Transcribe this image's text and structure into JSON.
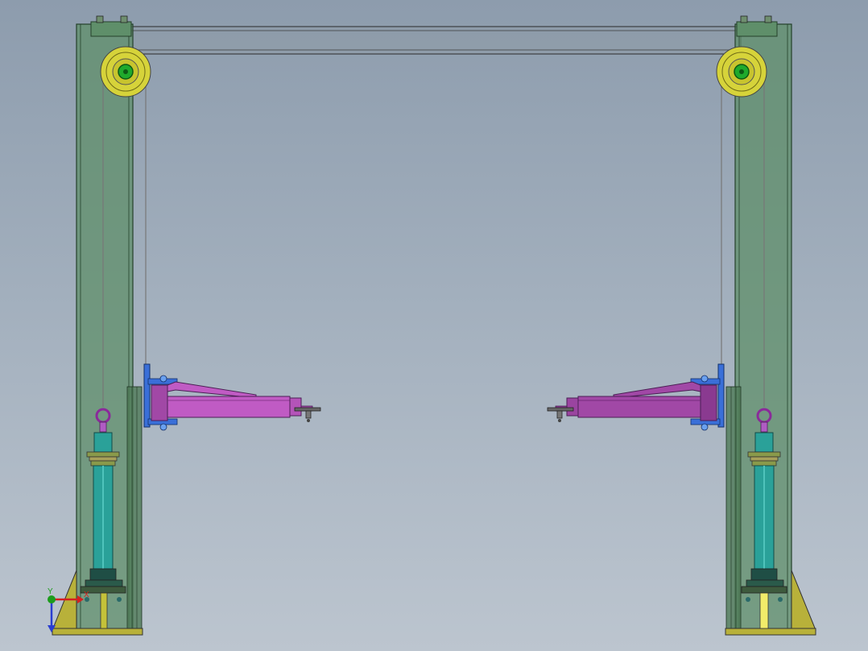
{
  "scene": {
    "title": "",
    "background": {
      "top": "#8d9cad",
      "bottom": "#bcc5cf"
    },
    "colors": {
      "column": "#5f8f6a",
      "column_edge": "#24402a",
      "beam": "#8e9aa6",
      "pulley_rim": "#d6d33a",
      "pulley_hub": "#1faa2c",
      "arm": "#c05bc4",
      "arm_dark": "#a148a6",
      "carriage": "#3a6fd8",
      "cylinder": "#2aa199",
      "base_plate": "#b8b13a",
      "cable": "#777777"
    },
    "icons": [
      "pulley-icon",
      "hydraulic-cylinder-icon",
      "lift-arm-icon",
      "coordinate-triad-icon"
    ]
  },
  "triad": {
    "x_label": "X",
    "y_label": "Y",
    "x_color": "#d42020",
    "y_color": "#1c9c1c",
    "z_color": "#2a3ed0"
  }
}
